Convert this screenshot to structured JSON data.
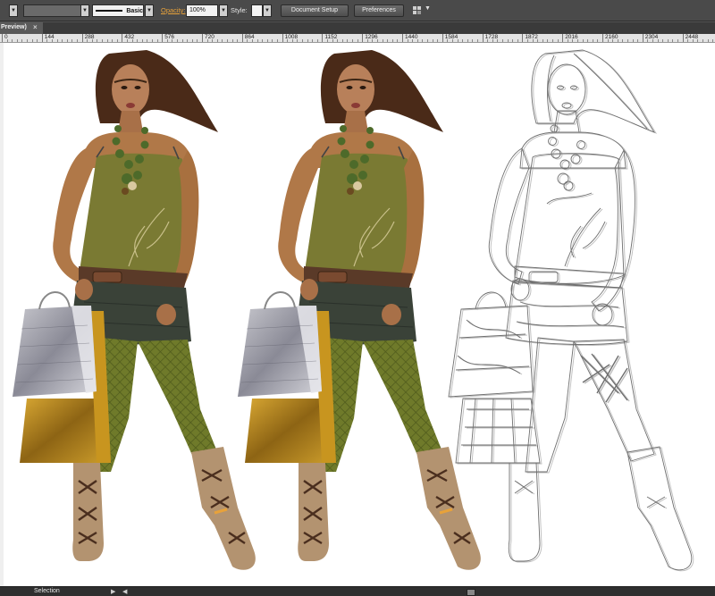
{
  "control_bar": {
    "brush_definition_label": "Basic",
    "opacity_label": "Opacity:",
    "opacity_value": "100%",
    "style_label": "Style:",
    "document_setup_label": "Document Setup",
    "preferences_label": "Preferences"
  },
  "tab_bar": {
    "document_tab_label": "Preview)",
    "close_glyph": "×"
  },
  "ruler": {
    "labels": [
      "0",
      "144",
      "288",
      "432",
      "576",
      "720",
      "864",
      "1008",
      "1152",
      "1296",
      "1440",
      "1584",
      "1728",
      "1872",
      "2016",
      "2160",
      "2304",
      "2448"
    ]
  },
  "status_bar": {
    "tool_label": "Selection",
    "next_glyph": "▶",
    "prev_glyph": "◀"
  },
  "colors": {
    "skin": "#b07848",
    "top": "#7a7a33",
    "skirt": "#3a4238",
    "tights": "#6f7a2a",
    "boots": "#b39370",
    "hair": "#4a2a18",
    "bag_silver": "#9a9aa4",
    "bag_gold": "#b0841e",
    "accent_orange": "#e8a23a"
  },
  "icons": {
    "arrange": "arrange-documents-icon",
    "dropdown": "chevron-down-icon"
  }
}
